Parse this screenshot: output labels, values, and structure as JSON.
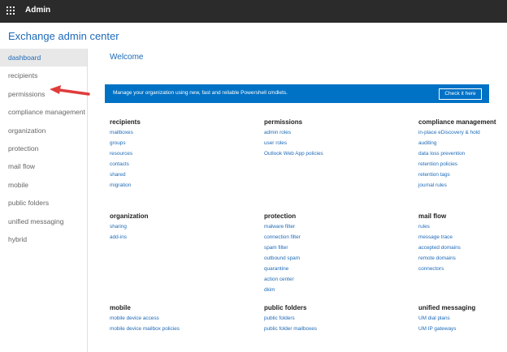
{
  "topbar": {
    "app_title": "Admin"
  },
  "page_title": "Exchange admin center",
  "sidebar": {
    "items": [
      {
        "label": "dashboard"
      },
      {
        "label": "recipients"
      },
      {
        "label": "permissions"
      },
      {
        "label": "compliance management"
      },
      {
        "label": "organization"
      },
      {
        "label": "protection"
      },
      {
        "label": "mail flow"
      },
      {
        "label": "mobile"
      },
      {
        "label": "public folders"
      },
      {
        "label": "unified messaging"
      },
      {
        "label": "hybrid"
      }
    ]
  },
  "main": {
    "welcome": "Welcome",
    "banner": {
      "text": "Manage your organization using new, fast and reliable Powershell cmdlets.",
      "button": "Check it here"
    },
    "sections": [
      {
        "title": "recipients",
        "links": [
          "mailboxes",
          "groups",
          "resources",
          "contacts",
          "shared",
          "migration"
        ]
      },
      {
        "title": "permissions",
        "links": [
          "admin roles",
          "user roles",
          "Outlook Web App policies"
        ]
      },
      {
        "title": "compliance management",
        "links": [
          "in-place eDiscovery & hold",
          "auditing",
          "data loss prevention",
          "retention policies",
          "retention tags",
          "journal rules"
        ]
      },
      {
        "title": "organization",
        "links": [
          "sharing",
          "add-ins"
        ]
      },
      {
        "title": "protection",
        "links": [
          "malware filter",
          "connection filter",
          "spam filter",
          "outbound spam",
          "quarantine",
          "action center",
          "dkim"
        ]
      },
      {
        "title": "mail flow",
        "links": [
          "rules",
          "message trace",
          "accepted domains",
          "remote domains",
          "connectors"
        ]
      },
      {
        "title": "mobile",
        "links": [
          "mobile device access",
          "mobile device mailbox policies"
        ]
      },
      {
        "title": "public folders",
        "links": [
          "public folders",
          "public folder mailboxes"
        ]
      },
      {
        "title": "unified messaging",
        "links": [
          "UM dial plans",
          "UM IP gateways"
        ]
      }
    ]
  },
  "colors": {
    "accent": "#1e6ab7",
    "banner": "#0072c6",
    "topbar": "#2b2b2b",
    "arrow": "#e03c3c"
  },
  "icons": {
    "app_launcher": "waffle-icon",
    "annotation": "red-arrow-icon"
  }
}
